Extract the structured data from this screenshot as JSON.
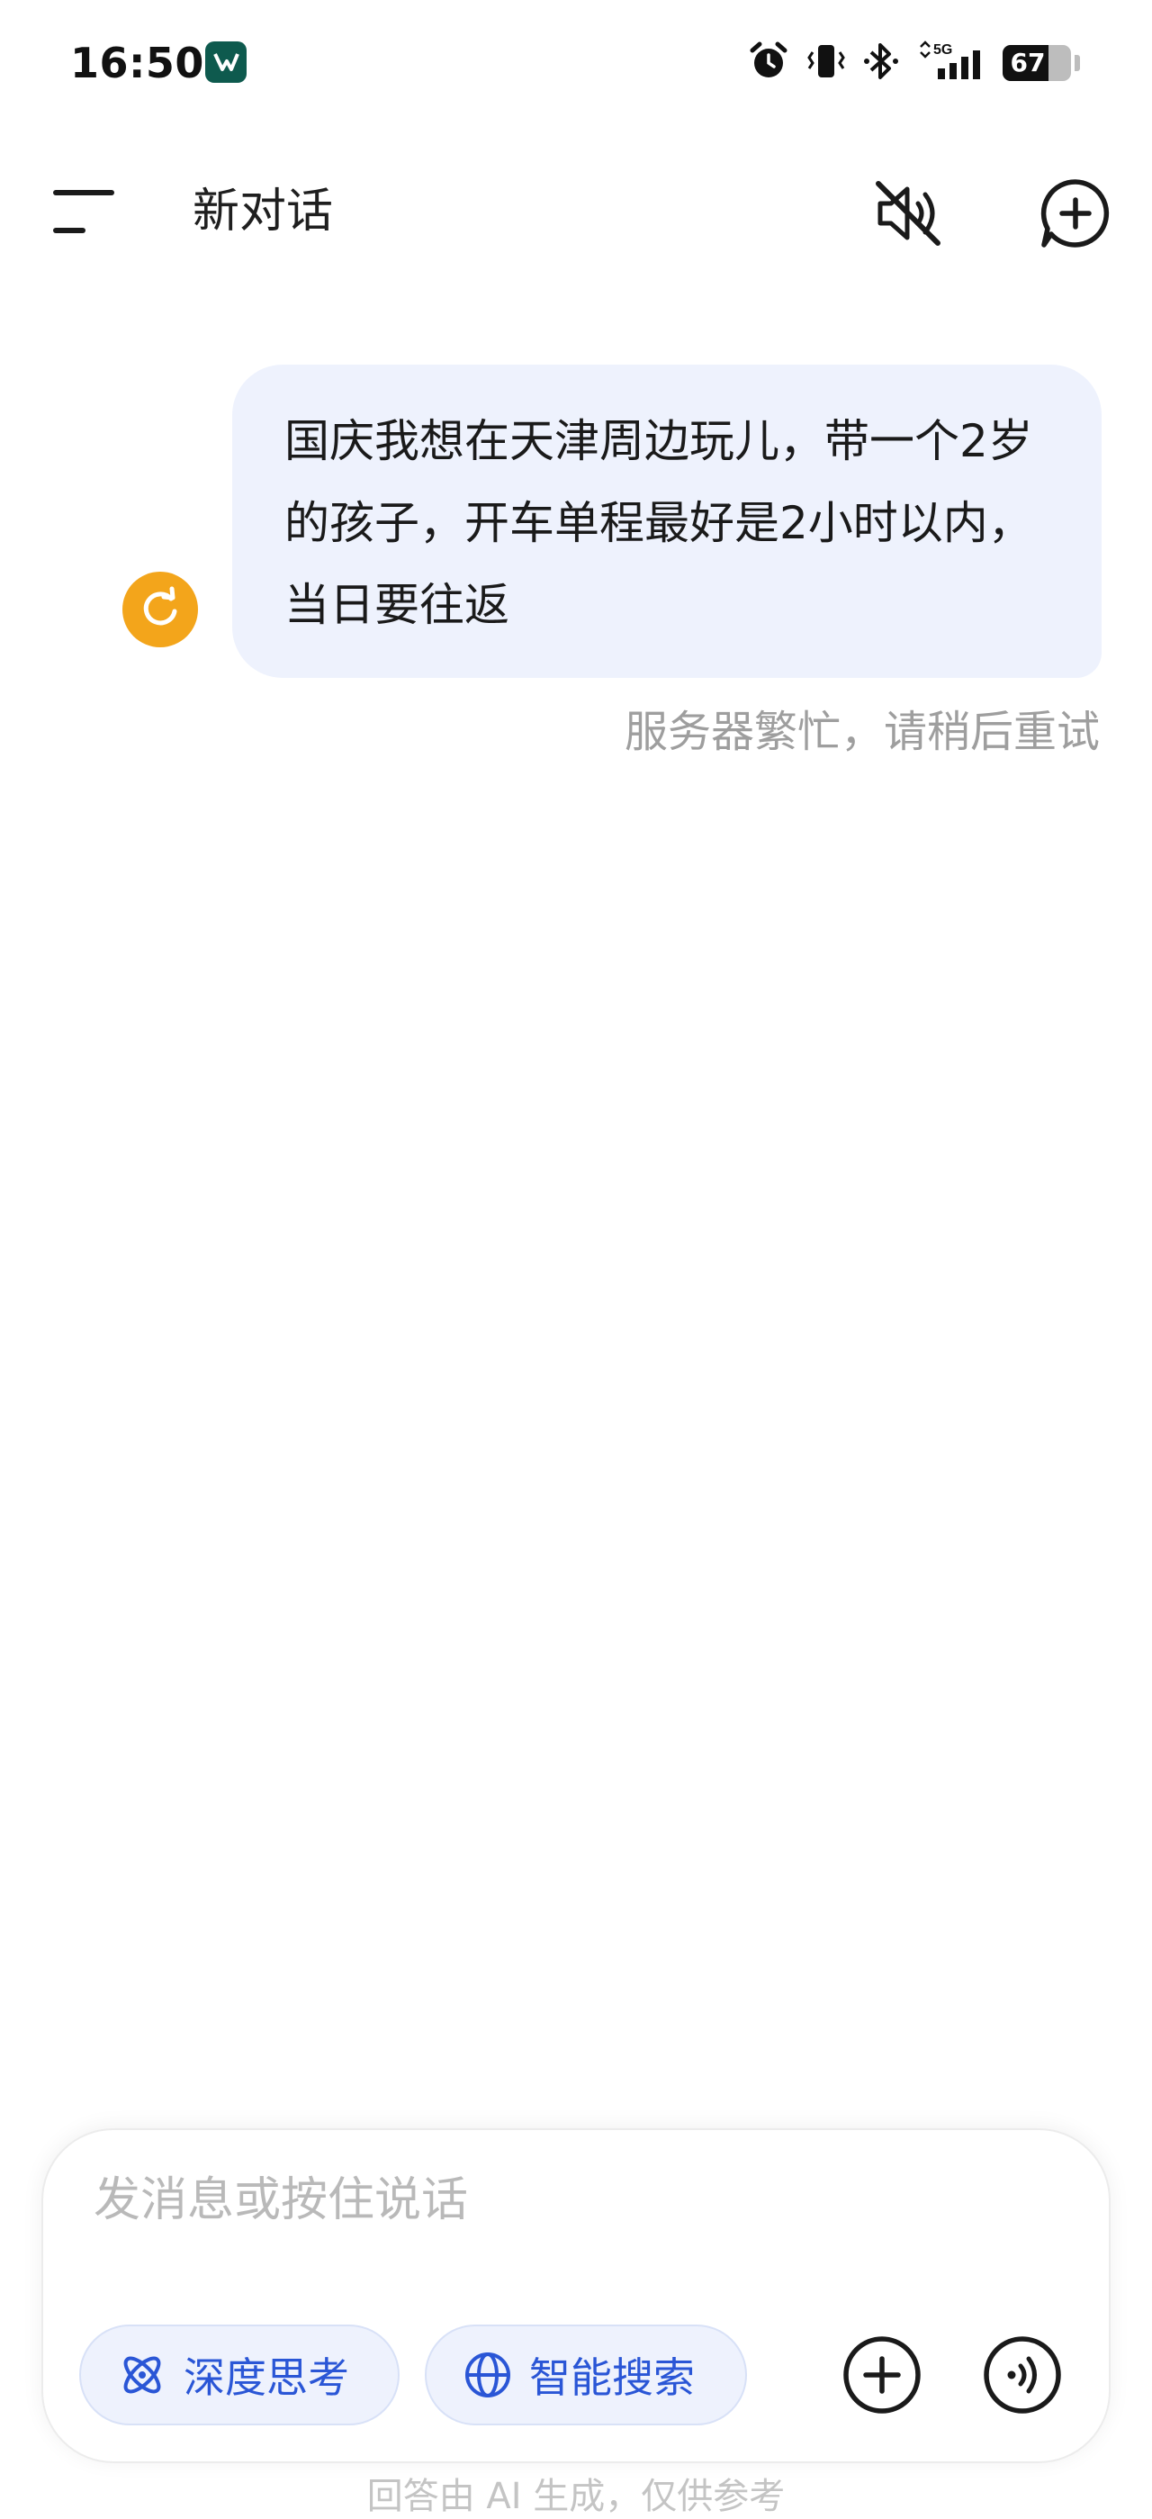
{
  "status_bar": {
    "time": "16:50",
    "battery_percent": 67,
    "battery_label": "67",
    "network_label": "5G",
    "icons": [
      "app-notification-icon",
      "alarm-icon",
      "vibrate-icon",
      "bluetooth-icon",
      "signal-5g-icon",
      "battery-icon"
    ]
  },
  "header": {
    "title": "新对话",
    "icons": [
      "menu-icon",
      "speaker-muted-icon",
      "new-chat-icon"
    ]
  },
  "conversation": {
    "user_message": "国庆我想在天津周边玩儿，带一个2岁的孩子，开车单程最好是2小时以内，当日要往返",
    "error_message": "服务器繁忙，请稍后重试",
    "retry_icon": "retry-icon"
  },
  "composer": {
    "placeholder": "发消息或按住说话",
    "deep_think_label": "深度思考",
    "web_search_label": "智能搜索",
    "icons": [
      "atom-icon",
      "globe-icon",
      "add-icon",
      "voice-call-icon"
    ]
  },
  "footer": {
    "disclaimer": "回答由 AI 生成，仅供参考"
  },
  "colors": {
    "bubble_bg": "#eef2fd",
    "accent_blue": "#2a56d6",
    "retry_orange": "#f3a51b",
    "muted_text": "#9e9e9e"
  }
}
